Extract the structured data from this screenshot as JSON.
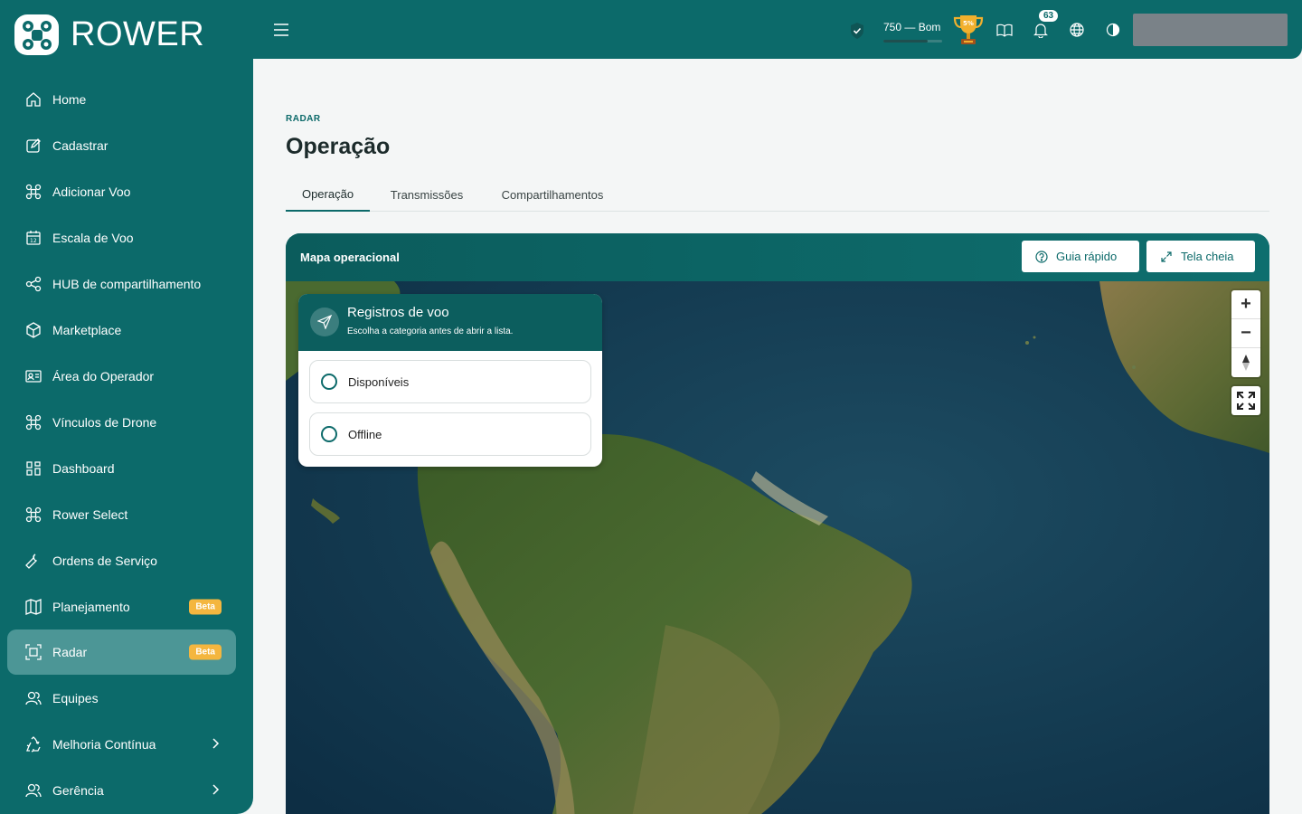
{
  "brand": {
    "name": "ROWER"
  },
  "sidebar": {
    "items": [
      {
        "label": "Home",
        "icon": "home-icon"
      },
      {
        "label": "Cadastrar",
        "icon": "edit-icon"
      },
      {
        "label": "Adicionar Voo",
        "icon": "drone-icon"
      },
      {
        "label": "Escala de Voo",
        "icon": "calendar-icon"
      },
      {
        "label": "HUB de compartilhamento",
        "icon": "share-icon"
      },
      {
        "label": "Marketplace",
        "icon": "box-icon"
      },
      {
        "label": "Área do Operador",
        "icon": "id-card-icon"
      },
      {
        "label": "Vínculos de Drone",
        "icon": "drone-icon"
      },
      {
        "label": "Dashboard",
        "icon": "grid-icon"
      },
      {
        "label": "Rower Select",
        "icon": "drone-icon"
      },
      {
        "label": "Ordens de Serviço",
        "icon": "wrench-icon"
      },
      {
        "label": "Planejamento",
        "icon": "map-icon",
        "badge": "Beta"
      },
      {
        "label": "Radar",
        "icon": "scan-icon",
        "badge": "Beta",
        "active": true
      },
      {
        "label": "Equipes",
        "icon": "users-icon"
      },
      {
        "label": "Melhoria Contínua",
        "icon": "recycle-icon",
        "chevron": true
      },
      {
        "label": "Gerência",
        "icon": "users-icon",
        "chevron": true
      }
    ]
  },
  "header": {
    "score_text": "750 — Bom",
    "score_fraction": 0.75,
    "trophy_badge": "5%",
    "notifications_count": "63"
  },
  "page": {
    "eyebrow": "RADAR",
    "title": "Operação",
    "tabs": [
      {
        "label": "Operação",
        "active": true
      },
      {
        "label": "Transmissões"
      },
      {
        "label": "Compartilhamentos"
      }
    ]
  },
  "map_card": {
    "title": "Mapa operacional",
    "guide_label": "Guia rápido",
    "fullscreen_label": "Tela cheia",
    "panel": {
      "title": "Registros de voo",
      "subtitle": "Escolha a categoria antes de abrir a lista.",
      "options": [
        "Disponíveis",
        "Offline"
      ]
    }
  },
  "colors": {
    "primary": "#0c6a6a",
    "active": "#4c9696",
    "beta": "#f4b63f"
  }
}
